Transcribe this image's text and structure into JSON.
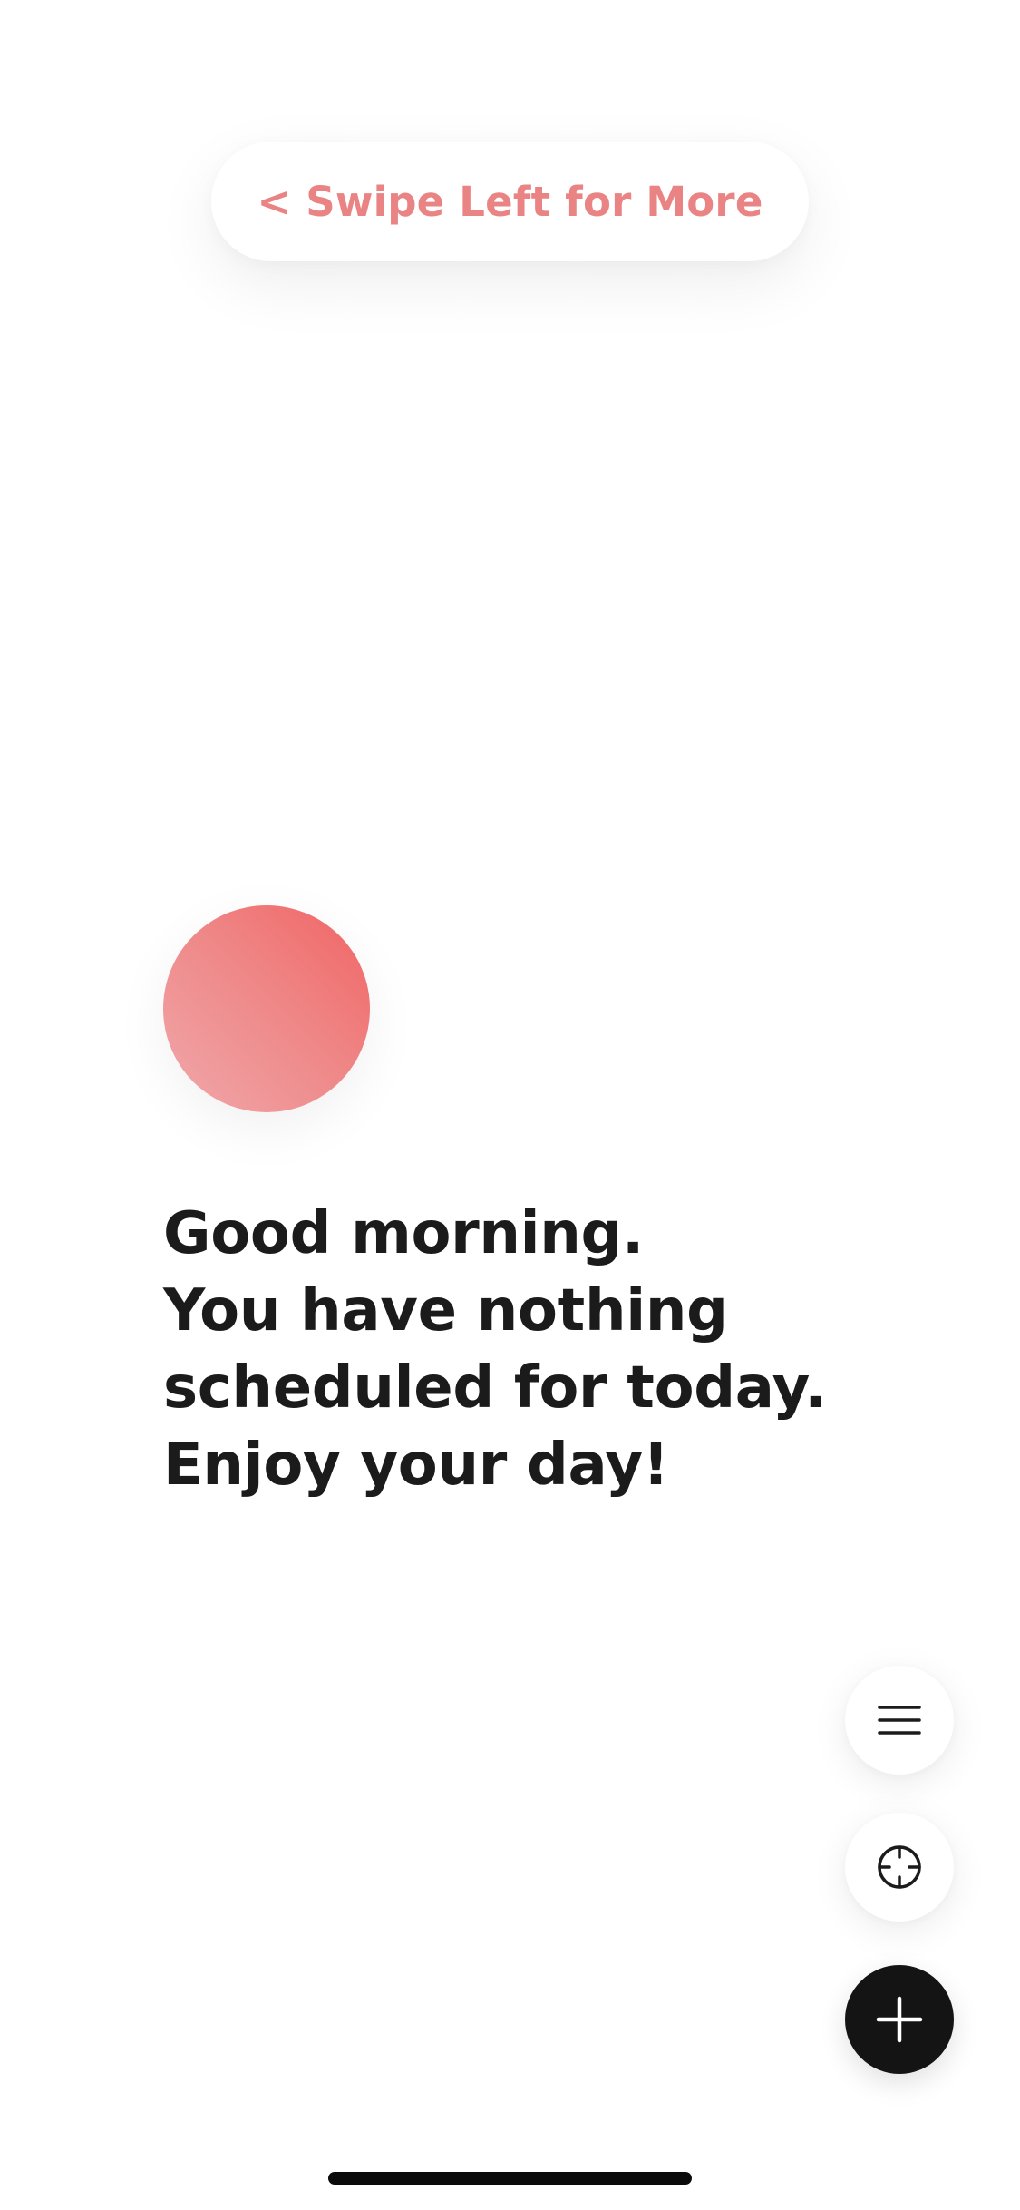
{
  "header": {
    "swipe_hint": "< Swipe Left for More"
  },
  "greeting": {
    "lines": [
      "Good morning.",
      "You have nothing",
      "scheduled for today.",
      "Enjoy your day!"
    ]
  },
  "actions": [
    {
      "icon": "menu-icon"
    },
    {
      "icon": "crosshair-icon"
    },
    {
      "icon": "plus-icon"
    }
  ],
  "colors": {
    "accent": "#ea8383",
    "orb_gradient": [
      "#f16464",
      "#f0a8ab"
    ],
    "text": "#1b1b1b",
    "dark_button": "#141414"
  }
}
